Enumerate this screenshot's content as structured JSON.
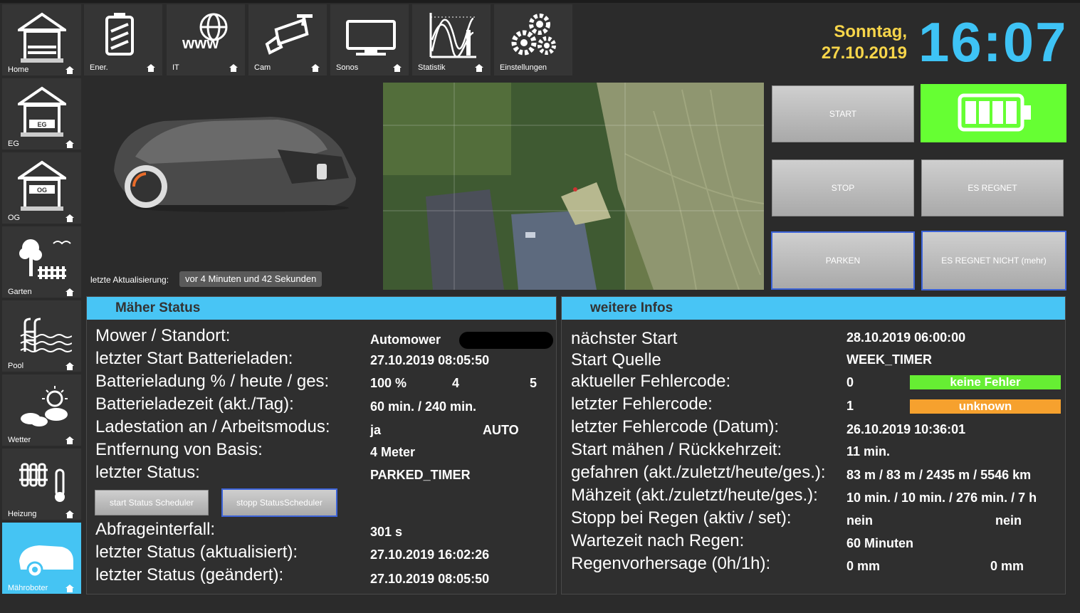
{
  "nav_top": [
    {
      "label": "Home",
      "icon": "house-icon"
    },
    {
      "label": "Ener.",
      "icon": "battery-icon"
    },
    {
      "label": "IT",
      "icon": "www-globe-icon"
    },
    {
      "label": "Cam",
      "icon": "camera-icon"
    },
    {
      "label": "Sonos",
      "icon": "monitor-icon"
    },
    {
      "label": "Statistik",
      "icon": "chart-icon"
    },
    {
      "label": "Einstellungen",
      "icon": "gears-icon"
    }
  ],
  "nav_side": [
    {
      "label": "EG",
      "icon_text": "EG"
    },
    {
      "label": "OG",
      "icon_text": "OG"
    },
    {
      "label": "Garten",
      "icon": "garden-icon"
    },
    {
      "label": "Pool",
      "icon": "pool-icon"
    },
    {
      "label": "Wetter",
      "icon": "weather-icon"
    },
    {
      "label": "Heizung",
      "icon": "heating-icon"
    },
    {
      "label": "Mähroboter",
      "icon": "mower-icon"
    }
  ],
  "header": {
    "day": "Sonntag,",
    "date": "27.10.2019",
    "time": "16:07"
  },
  "last_update": {
    "label": "letzte Aktualisierung:",
    "value": "vor 4 Minuten und 42 Sekunden"
  },
  "controls": {
    "start": "START",
    "stop": "STOP",
    "rain": "ES REGNET",
    "park": "PARKEN",
    "no_rain": "ES REGNET NICHT (mehr)"
  },
  "colors": {
    "accent": "#48c5f5",
    "clock": "#3ec3f5",
    "date": "#f7d54a",
    "battery": "#66ff33",
    "ok_badge": "#66ee33",
    "warn_badge": "#f6a12e"
  },
  "status_panel": {
    "title": "Mäher Status",
    "rows": [
      {
        "label": "Mower / Standort:",
        "v1": "Automower",
        "v2": "",
        "v3": ""
      },
      {
        "label": "letzter Start Batterieladen:",
        "v1": "27.10.2019 08:05:50",
        "v2": "",
        "v3": ""
      },
      {
        "label": "Batterieladung % / heute / ges:",
        "v1": "100 %",
        "v2": "4",
        "v3": "5"
      },
      {
        "label": "Batterieladezeit (akt./Tag):",
        "v1": "60 min. / 240 min.",
        "v2": "",
        "v3": ""
      },
      {
        "label": "Ladestation an / Arbeitsmodus:",
        "v1": "ja",
        "v2": "AUTO",
        "v3": ""
      },
      {
        "label": "Entfernung von Basis:",
        "v1": "4 Meter",
        "v2": "",
        "v3": ""
      },
      {
        "label": "letzter Status:",
        "v1": "PARKED_TIMER",
        "v2": "",
        "v3": ""
      }
    ],
    "btn_start": "start Status Scheduler",
    "btn_stop": "stopp StatusScheduler",
    "rows2": [
      {
        "label": "Abfrageinterfall:",
        "v1": "301 s"
      },
      {
        "label": "letzter Status (aktualisiert):",
        "v1": "27.10.2019 16:02:26"
      },
      {
        "label": "letzter Status (geändert):",
        "v1": "27.10.2019 08:05:50"
      }
    ]
  },
  "info_panel": {
    "title": "weitere Infos",
    "rows": [
      {
        "label": "nächster Start",
        "v1": "28.10.2019 06:00:00",
        "v2": ""
      },
      {
        "label": "Start Quelle",
        "v1": "WEEK_TIMER",
        "v2": ""
      },
      {
        "label": "aktueller Fehlercode:",
        "v1": "0",
        "badge": "keine Fehler"
      },
      {
        "label": "letzter Fehlercode:",
        "v1": "1",
        "badge": "unknown"
      },
      {
        "label": "letzter Fehlercode (Datum):",
        "v1": "26.10.2019 10:36:01",
        "v2": ""
      },
      {
        "label": "Start mähen / Rückkehrzeit:",
        "v1": "11 min.",
        "v2": ""
      },
      {
        "label": "gefahren (akt./zuletzt/heute/ges.):",
        "v1": "83 m / 83 m / 2435 m / 5546 km",
        "v2": ""
      },
      {
        "label": "Mähzeit (akt./zuletzt/heute/ges.):",
        "v1": "10 min. / 10 min. / 276 min. / 7 h",
        "v2": ""
      },
      {
        "label": "Stopp bei Regen (aktiv / set):",
        "v1": "nein",
        "v2": "nein"
      },
      {
        "label": "Wartezeit nach Regen:",
        "v1": "60 Minuten",
        "v2": ""
      },
      {
        "label": "Regenvorhersage (0h/1h):",
        "v1": "0 mm",
        "v2": "0 mm"
      }
    ]
  }
}
